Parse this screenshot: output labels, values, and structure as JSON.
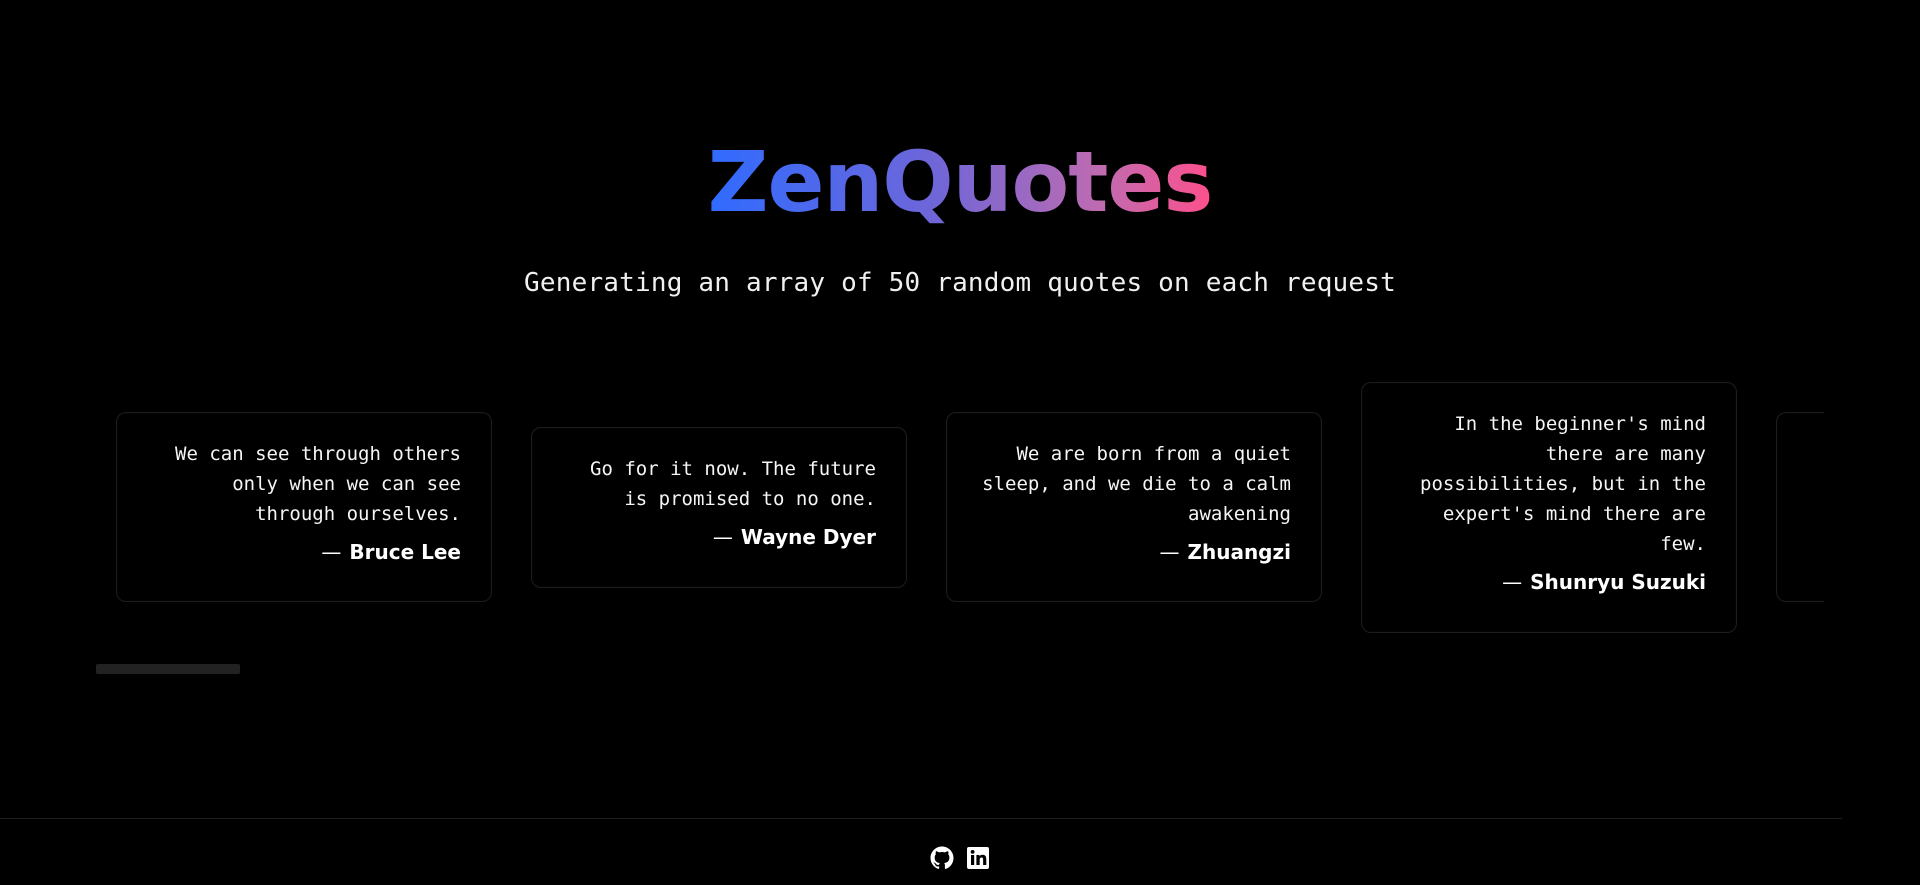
{
  "header": {
    "title": "ZenQuotes",
    "subtitle": "Generating an array of 50 random quotes on each request"
  },
  "quotes": [
    {
      "text": "We can see through others only when we can see through ourselves.",
      "author": "Bruce Lee"
    },
    {
      "text": "Go for it now. The future is promised to no one.",
      "author": "Wayne Dyer"
    },
    {
      "text": "We are born from a quiet sleep, and we die to a calm awakening",
      "author": "Zhuangzi"
    },
    {
      "text": "In the beginner's mind there are many possibilities, but in the expert's mind there are few.",
      "author": "Shunryu Suzuki"
    },
    {
      "text": "",
      "author": ""
    }
  ],
  "footer": {
    "github_icon": "github-icon",
    "linkedin_icon": "linkedin-icon"
  },
  "colors": {
    "background": "#000000",
    "title_gradient": [
      "#2f6bff",
      "#6f66d8",
      "#c06bb0",
      "#ff4f8b"
    ],
    "card_border": "#1d1d1d",
    "scroll_thumb": "#222222"
  }
}
